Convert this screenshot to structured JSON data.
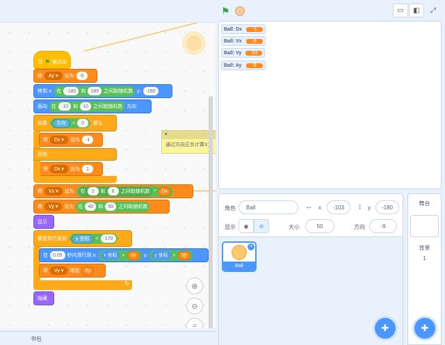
{
  "toolbar": {
    "flag_icon": "green-flag-icon",
    "stop_icon": "stop-icon"
  },
  "code": {
    "hat": {
      "label": "当",
      "suffix": "被点击"
    },
    "b1": {
      "l1": "将",
      "var": "Ay",
      "l2": "设为",
      "v": "-5"
    },
    "b2": {
      "l1": "移到 x:",
      "l2": "在",
      "a": "-180",
      "l3": "和",
      "b": "180",
      "l4": "之间取随机数",
      "l5": "y:",
      "y": "-160"
    },
    "b3": {
      "l1": "面向",
      "l2": "在",
      "a": "-10",
      "l3": "和",
      "b": "10",
      "l4": "之间取随机数",
      "l5": "方向"
    },
    "b4": {
      "l1": "如果",
      "s": "方向",
      "lt": "<",
      "v": "0",
      "l2": "那么"
    },
    "b5": {
      "l1": "将",
      "var": "Dx",
      "l2": "设为",
      "v": "-1"
    },
    "else": "否则",
    "b6": {
      "l1": "将",
      "var": "Dx",
      "l2": "设为",
      "v": "1"
    },
    "b7": {
      "l1": "将",
      "var": "Vx",
      "l2": "设为",
      "l3": "在",
      "a": "2",
      "l4": "和",
      "b": "6",
      "l5": "之间取随机数",
      "mul": "*",
      "r": "Dx"
    },
    "b8": {
      "l1": "将",
      "var": "Vy",
      "l2": "设为",
      "l3": "在",
      "a": "40",
      "l4": "和",
      "b": "50",
      "l5": "之间取随机数"
    },
    "show": "显示",
    "b9": {
      "l1": "重复执行直到",
      "s": "y 坐标",
      "lt": "<",
      "v": "-170"
    },
    "b10": {
      "l1": "在",
      "t": "0.05",
      "l2": "秒内滑行到 x:",
      "sx": "x 坐标",
      "p1": "+",
      "vx": "Vx",
      "l3": "y:",
      "sy": "y 坐标",
      "p2": "+",
      "vy": "Vy"
    },
    "b11": {
      "l1": "将",
      "var": "Vy",
      "l2": "增加",
      "r": "Ay"
    },
    "hide": "隐藏",
    "comment": "通过方向正负计算X方",
    "backpack": "书包"
  },
  "monitors": [
    {
      "name": "Ball: Dx",
      "value": "-1"
    },
    {
      "name": "Ball: Vx",
      "value": "-6"
    },
    {
      "name": "Ball: Vy",
      "value": "-54"
    },
    {
      "name": "Ball: Ay",
      "value": "-5"
    }
  ],
  "sprite_info": {
    "sprite_label": "角色",
    "sprite_name": "Ball",
    "x_label": "x",
    "x": "-103",
    "y_label": "y",
    "y": "-180",
    "show_label": "显示",
    "size_label": "大小",
    "size": "50",
    "direction_label": "方向",
    "direction": "-9"
  },
  "sprites": [
    {
      "name": "Ball"
    }
  ],
  "stage_pane": {
    "title": "舞台",
    "backdrops_label": "背景",
    "backdrops_count": "1"
  }
}
